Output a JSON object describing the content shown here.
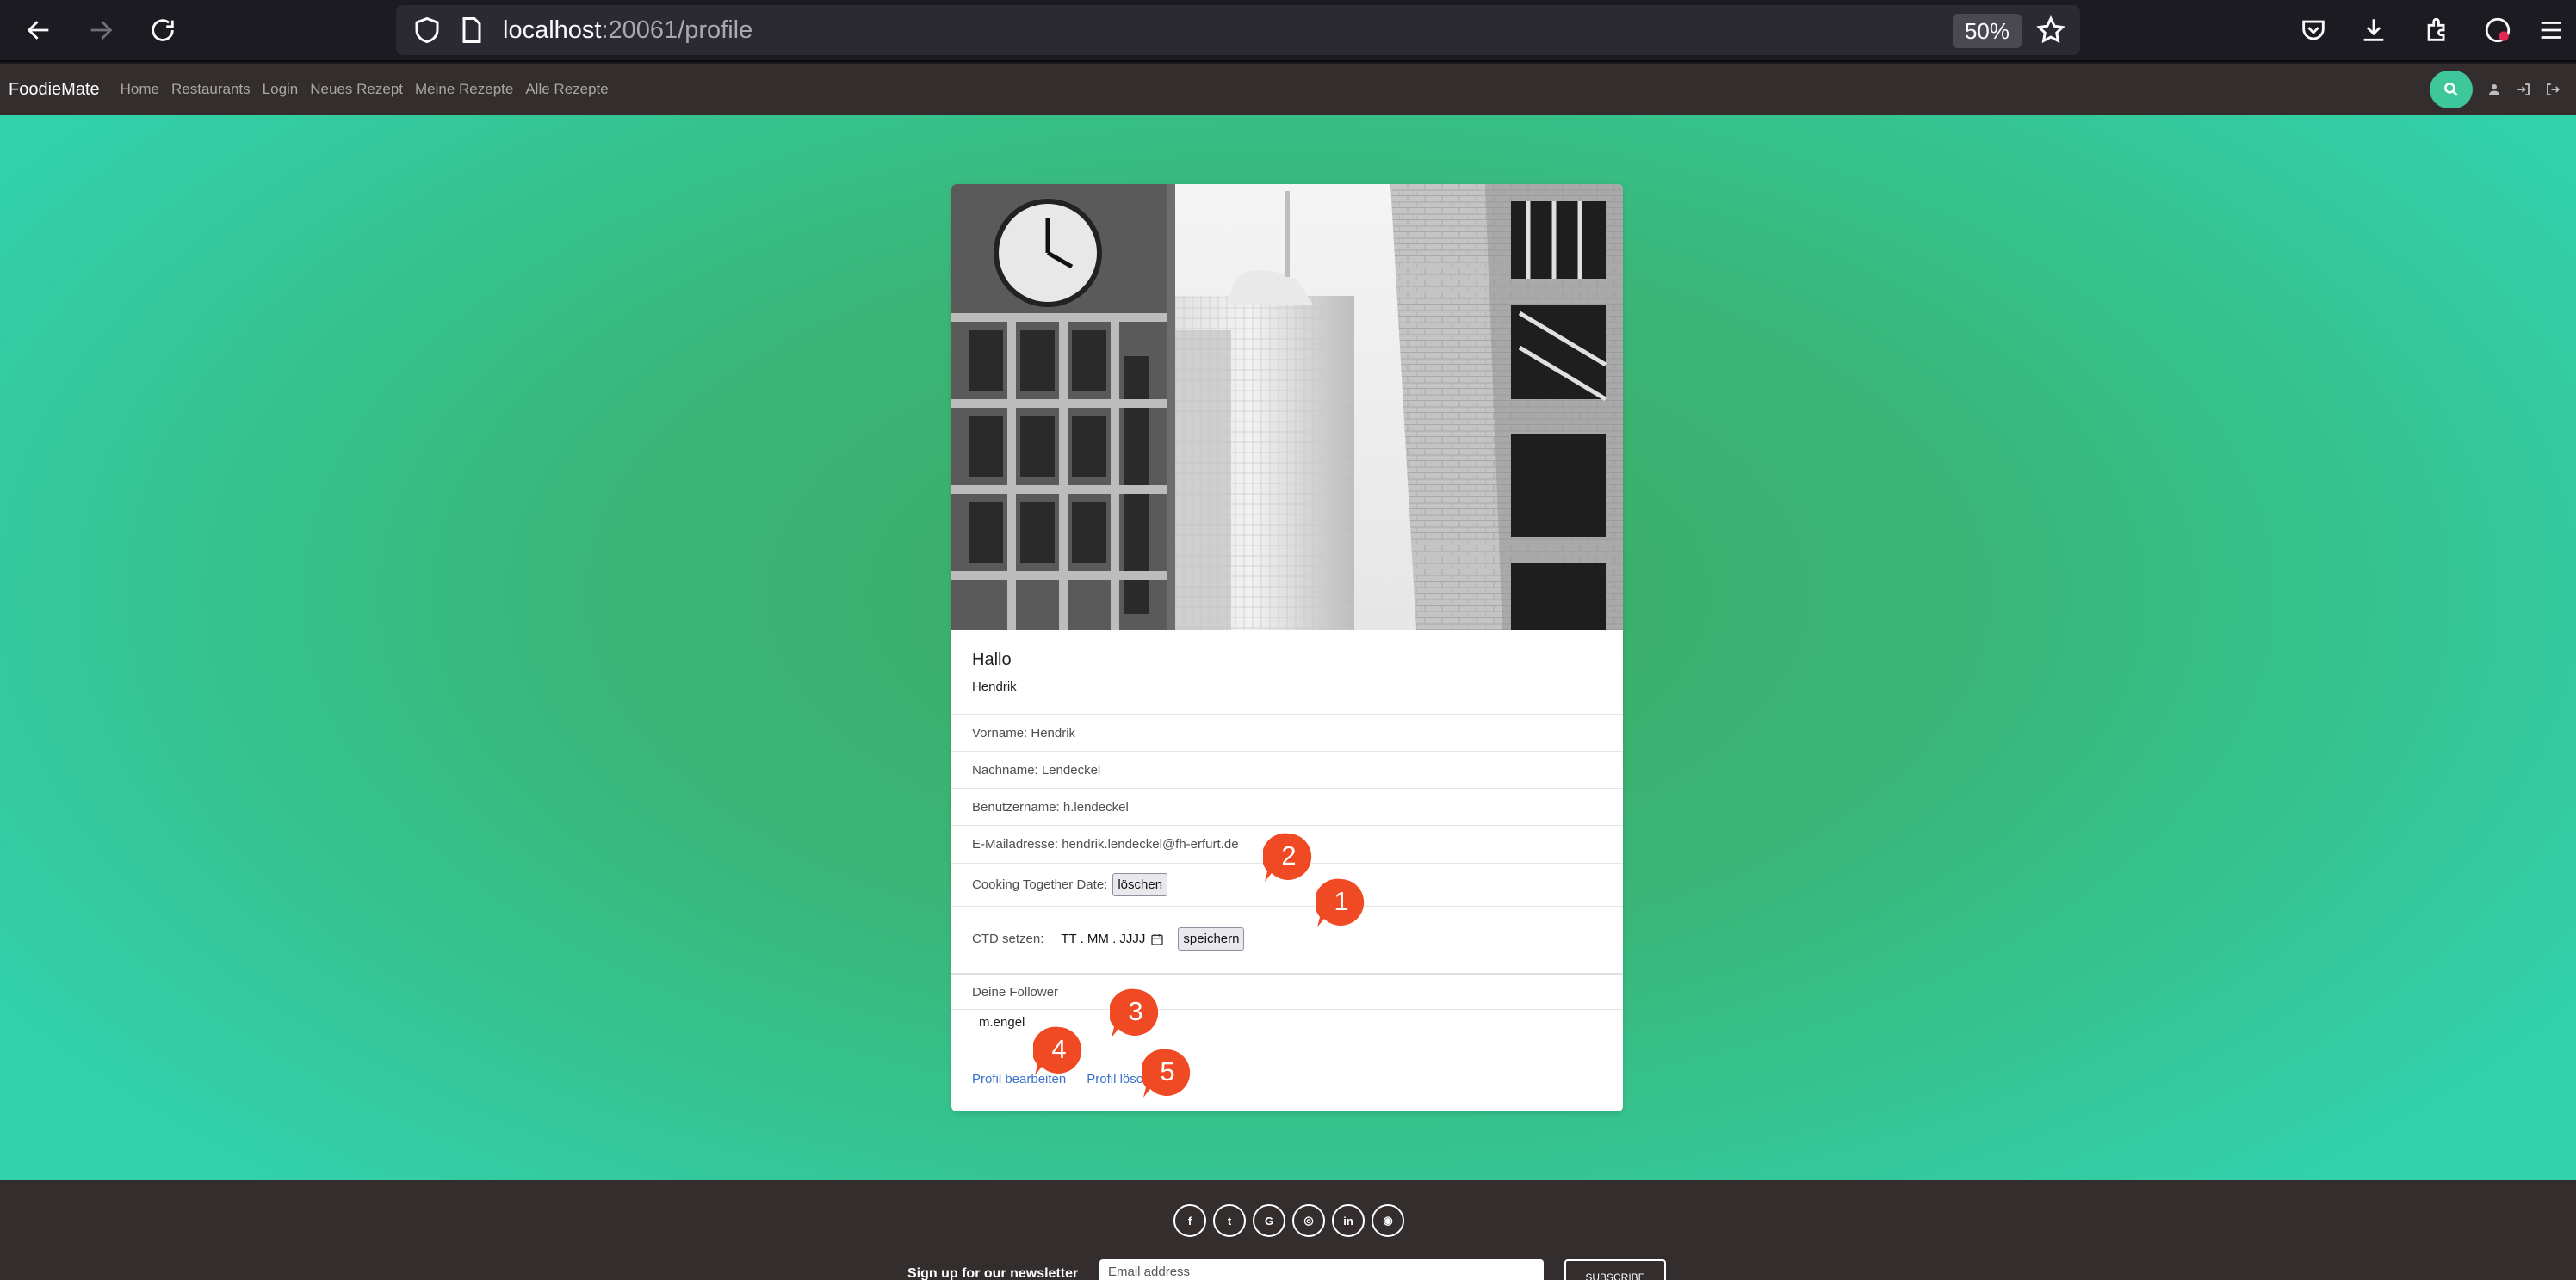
{
  "browser": {
    "url_host": "localhost",
    "url_rest": ":20061/profile",
    "zoom": "50%"
  },
  "navbar": {
    "brand": "FoodieMate",
    "links": [
      "Home",
      "Restaurants",
      "Login",
      "Neues Rezept",
      "Meine Rezepte",
      "Alle Rezepte"
    ]
  },
  "profile": {
    "greeting": "Hallo",
    "name": "Hendrik",
    "vorname": "Vorname: Hendrik",
    "nachname": "Nachname: Lendeckel",
    "benutzername": "Benutzername: h.lendeckel",
    "email": "E-Mailadresse: hendrik.lendeckel@fh-erfurt.de",
    "ctd_label": "Cooking Together Date:",
    "ctd_delete": "löschen",
    "ctd_set_label": "CTD setzen:",
    "date_placeholder": "TT . MM . JJJJ",
    "save": "speichern",
    "followers_label": "Deine Follower",
    "followers": [
      "m.engel"
    ],
    "edit_link": "Profil bearbeiten",
    "delete_link": "Profil löschen"
  },
  "annotations": [
    "1",
    "2",
    "3",
    "4",
    "5"
  ],
  "colors": {
    "marker": "#f04a24",
    "accent": "#3fc79c",
    "link": "#3b71ca"
  },
  "footer": {
    "socials": [
      "f",
      "t",
      "G",
      "◎",
      "in",
      "◉"
    ],
    "newsletter_label": "Sign up for our newsletter",
    "email_placeholder": "Email address",
    "subscribe": "SUBSCRIBE"
  }
}
